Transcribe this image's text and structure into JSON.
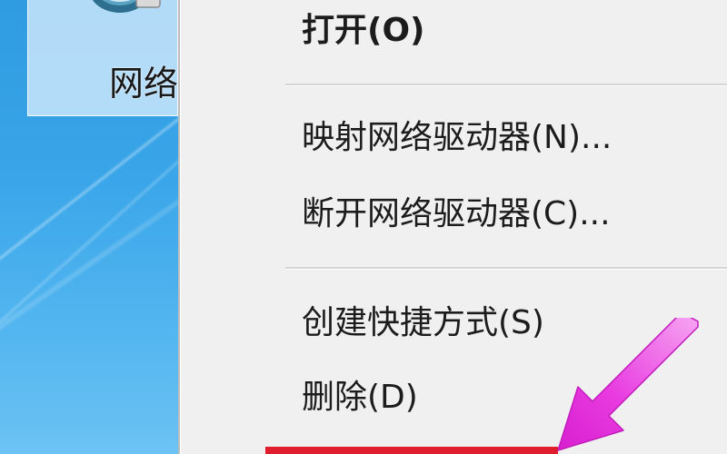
{
  "desktop": {
    "selected_icon_label": "网络",
    "icon": "network-icon"
  },
  "context_menu": {
    "items": [
      {
        "label": "打开(O)",
        "bold": true
      },
      {
        "label": "映射网络驱动器(N)..."
      },
      {
        "label": "断开网络驱动器(C)..."
      },
      {
        "label": "创建快捷方式(S)"
      },
      {
        "label": "删除(D)"
      }
    ]
  },
  "annotation": {
    "arrow_color": "#e83be0",
    "highlight_color": "#e01d2c"
  }
}
